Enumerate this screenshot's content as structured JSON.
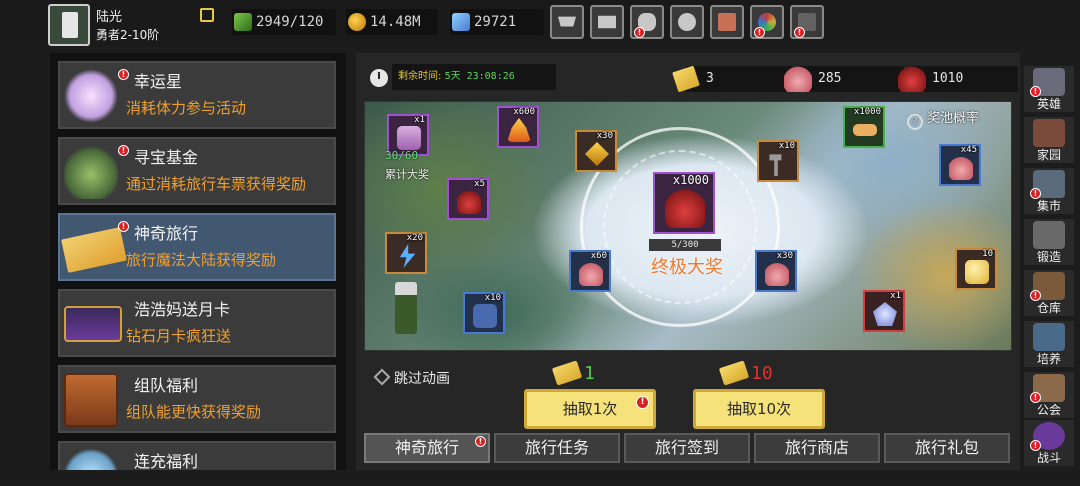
{
  "player": {
    "name": "陆光",
    "rank": "勇者2-10阶"
  },
  "resources": {
    "energy": "2949/120",
    "gold": "14.48M",
    "gems": "29721"
  },
  "toolbar": [
    {
      "name": "shop-icon",
      "badge": false
    },
    {
      "name": "mail-icon",
      "badge": false
    },
    {
      "name": "gamepad-icon",
      "badge": true
    },
    {
      "name": "settings-icon",
      "badge": false
    },
    {
      "name": "gift-icon",
      "badge": false
    },
    {
      "name": "color-wheel-icon",
      "badge": true
    },
    {
      "name": "firework-icon",
      "badge": true
    }
  ],
  "activities": [
    {
      "title": "幸运星",
      "desc": "消耗体力参与活动",
      "badge": true,
      "selected": false
    },
    {
      "title": "寻宝基金",
      "desc": "通过消耗旅行车票获得奖励",
      "badge": true,
      "selected": false
    },
    {
      "title": "神奇旅行",
      "desc": "旅行魔法大陆获得奖励",
      "badge": true,
      "selected": true
    },
    {
      "title": "浩浩妈送月卡",
      "desc": "钻石月卡疯狂送",
      "badge": false,
      "selected": false
    },
    {
      "title": "组队福利",
      "desc": "组队能更快获得奖励",
      "badge": false,
      "selected": false
    },
    {
      "title": "连充福利",
      "desc": "",
      "badge": false,
      "selected": false
    }
  ],
  "main": {
    "timer_label": "剩余时间:",
    "timer_value": "5天 23:08:26",
    "counts": {
      "tickets": "3",
      "pink_bags": "285",
      "red_bags": "1010"
    },
    "prize_rate": "奖池概率",
    "cumulative_progress": "30/60",
    "cumulative_label": "累计大奖",
    "grand_qty": "x1000",
    "grand_progress": "5/300",
    "grand_label": "终极大奖",
    "items": [
      {
        "qty": "x1"
      },
      {
        "qty": "x600"
      },
      {
        "qty": "x30"
      },
      {
        "qty": "x1000"
      },
      {
        "qty": "x5"
      },
      {
        "qty": "x10"
      },
      {
        "qty": "x45"
      },
      {
        "qty": "x20"
      },
      {
        "qty": "x60"
      },
      {
        "qty": "x30"
      },
      {
        "qty": "10"
      },
      {
        "qty": "x10"
      },
      {
        "qty": "x1"
      }
    ],
    "skip_label": "跳过动画",
    "cost_one": "1",
    "cost_ten": "10",
    "draw_one": "抽取1次",
    "draw_ten": "抽取10次",
    "tabs": [
      "神奇旅行",
      "旅行任务",
      "旅行签到",
      "旅行商店",
      "旅行礼包"
    ]
  },
  "rightnav": [
    {
      "label": "英雄",
      "icon": "hero-icon"
    },
    {
      "label": "家园",
      "icon": "home-icon"
    },
    {
      "label": "集市",
      "icon": "market-icon"
    },
    {
      "label": "锻造",
      "icon": "forge-icon"
    },
    {
      "label": "仓库",
      "icon": "warehouse-icon"
    },
    {
      "label": "培养",
      "icon": "training-icon"
    },
    {
      "label": "公会",
      "icon": "guild-icon"
    },
    {
      "label": "战斗",
      "icon": "battle-icon"
    }
  ]
}
